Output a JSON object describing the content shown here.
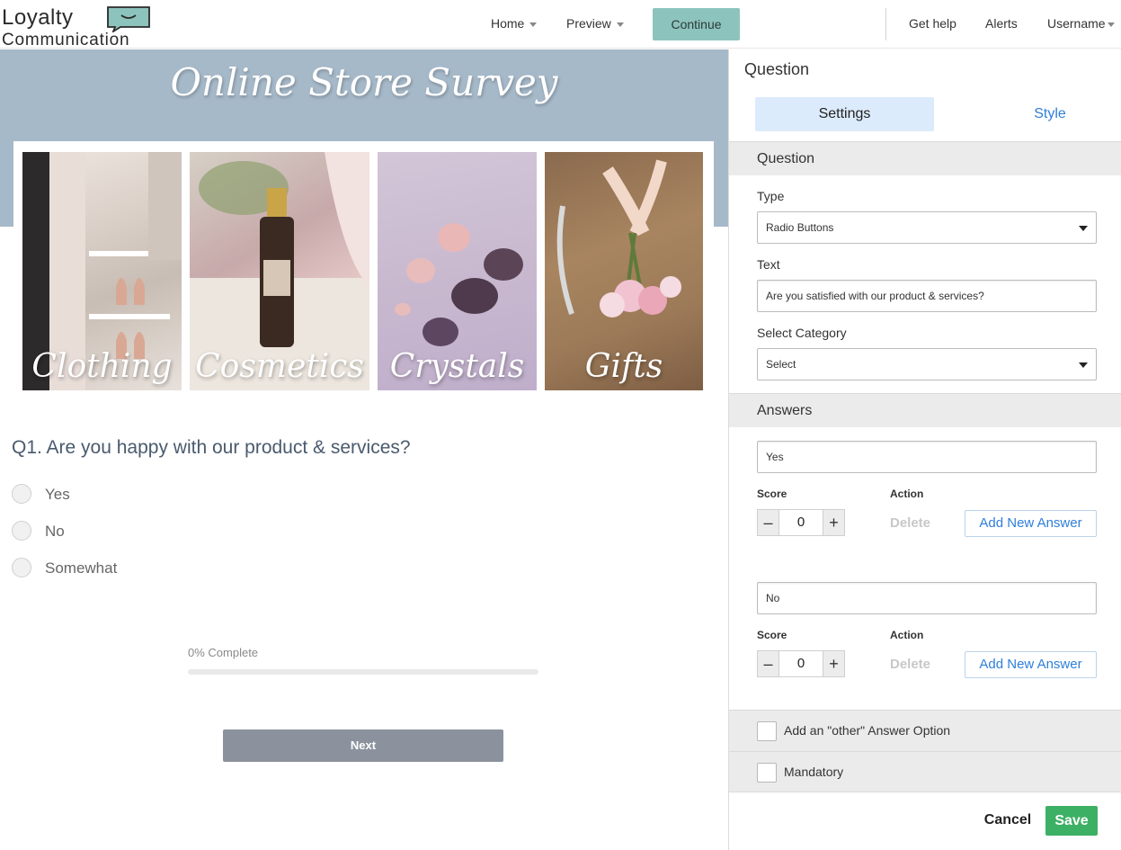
{
  "app": {
    "logo_line1": "Loyalty",
    "logo_line2": "Communication"
  },
  "nav": {
    "home": "Home",
    "preview": "Preview",
    "continue": "Continue",
    "get_help": "Get help",
    "alerts": "Alerts",
    "username": "Username"
  },
  "survey": {
    "title": "Online Store Survey",
    "categories": [
      "Clothing",
      "Cosmetics",
      "Crystals",
      "Gifts"
    ],
    "question": "Q1. Are you happy with our product & services?",
    "options": [
      "Yes",
      "No",
      "Somewhat"
    ],
    "progress_label": "0% Complete",
    "progress_value": 0,
    "next": "Next"
  },
  "panel": {
    "title": "Question",
    "tabs": {
      "settings": "Settings",
      "style": "Style"
    },
    "question_section": "Question",
    "type_label": "Type",
    "type_value": "Radio Buttons",
    "text_label": "Text",
    "text_value": "Are you satisfied with our product & services?",
    "category_label": "Select Category",
    "category_value": "Select",
    "answers_section": "Answers",
    "answers": [
      {
        "value": "Yes",
        "score_label": "Score",
        "action_label": "Action",
        "score": "0",
        "delete": "Delete",
        "add": "Add New Answer"
      },
      {
        "value": "No",
        "score_label": "Score",
        "action_label": "Action",
        "score": "0",
        "delete": "Delete",
        "add": "Add New Answer"
      }
    ],
    "other_option": "Add an \"other\" Answer Option",
    "mandatory": "Mandatory",
    "cancel": "Cancel",
    "save": "Save"
  },
  "colors": {
    "banner": "#a6b9c9",
    "continue": "#8dc3bd",
    "tab_active": "#dcebfb",
    "link": "#2e7fd9",
    "save": "#3cb064",
    "next": "#8b929d"
  }
}
